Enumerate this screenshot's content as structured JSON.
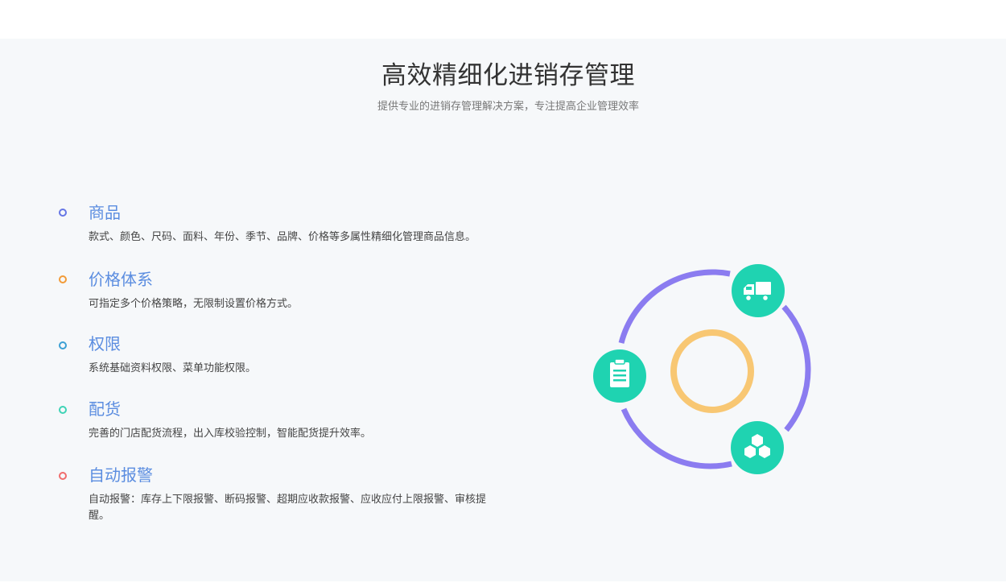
{
  "section": {
    "title": "高效精细化进销存管理",
    "subtitle": "提供专业的进销存管理解决方案，专注提高企业管理效率"
  },
  "features": [
    {
      "title": "商品",
      "description": "款式、颜色、尺码、面料、年份、季节、品牌、价格等多属性精细化管理商品信息。",
      "dot_color": "#6576e5"
    },
    {
      "title": "价格体系",
      "description": "可指定多个价格策略，无限制设置价格方式。",
      "dot_color": "#f29b38"
    },
    {
      "title": "权限",
      "description": "系统基础资料权限、菜单功能权限。",
      "dot_color": "#3ca0d4"
    },
    {
      "title": "配货",
      "description": "完善的门店配货流程，出入库校验控制，智能配货提升效率。",
      "dot_color": "#3ed3b6"
    },
    {
      "title": "自动报警",
      "description": "自动报警：库存上下限报警、断码报警、超期应收款报警、应收应付上限报警、审核提醒。",
      "dot_color": "#f06c6c"
    }
  ],
  "graphic": {
    "icons": [
      "truck-icon",
      "clipboard-icon",
      "cubes-icon"
    ],
    "ring_color": "#8b7cf0",
    "inner_ring_color": "#f8c773",
    "icon_bg_color": "#1fd3b1"
  }
}
